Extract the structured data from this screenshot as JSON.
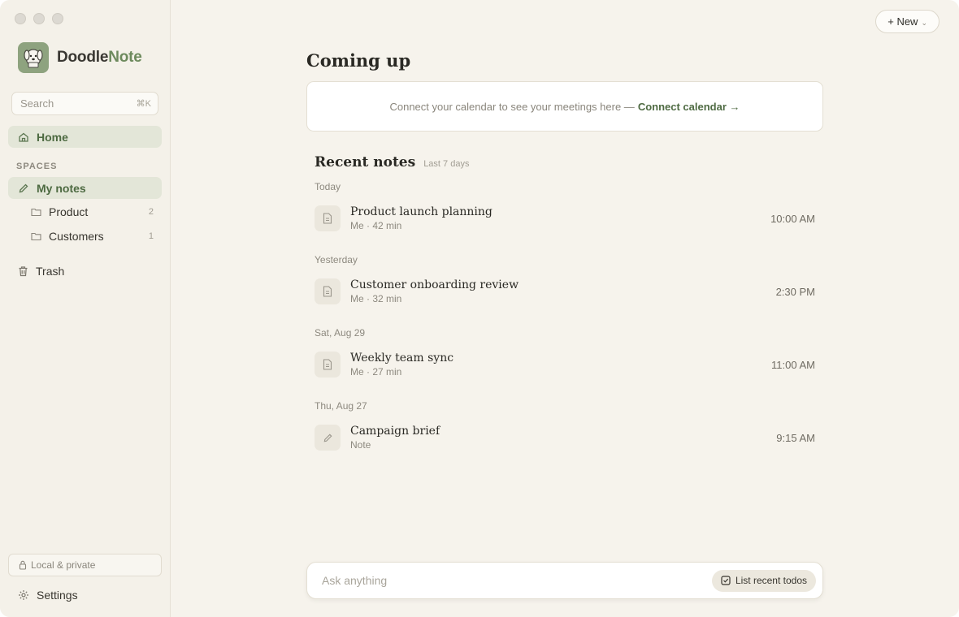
{
  "app": {
    "brand_main": "Doodle",
    "brand_accent": "Note",
    "accent_color": "#6d8a5d"
  },
  "sidebar": {
    "search_placeholder": "Search",
    "search_shortcut": "⌘K",
    "home_label": "Home",
    "spaces_label": "SPACES",
    "my_notes_label": "My notes",
    "folders": [
      {
        "label": "Product",
        "count": "2"
      },
      {
        "label": "Customers",
        "count": "1"
      }
    ],
    "trash_label": "Trash",
    "local_label": "Local & private",
    "settings_label": "Settings"
  },
  "header": {
    "new_button_label": "+ New"
  },
  "coming_up": {
    "title": "Coming up",
    "calendar_text": "Connect your calendar to see your meetings here —",
    "calendar_link": "Connect calendar →"
  },
  "recent": {
    "title": "Recent notes",
    "subtitle": "Last 7 days",
    "groups": [
      {
        "day": "Today",
        "note": {
          "title": "Product launch planning",
          "meta": "Me · 42 min",
          "time": "10:00 AM",
          "icon": "document-icon"
        }
      },
      {
        "day": "Yesterday",
        "note": {
          "title": "Customer onboarding review",
          "meta": "Me · 32 min",
          "time": "2:30 PM",
          "icon": "document-icon"
        }
      },
      {
        "day": "Sat, Aug 29",
        "note": {
          "title": "Weekly team sync",
          "meta": "Me · 27 min",
          "time": "11:00 AM",
          "icon": "document-icon"
        }
      },
      {
        "day": "Thu, Aug 27",
        "note": {
          "title": "Campaign brief",
          "meta": "Note",
          "time": "9:15 AM",
          "icon": "pencil-icon"
        }
      }
    ]
  },
  "ask": {
    "placeholder": "Ask anything",
    "chip_label": "List recent todos"
  }
}
